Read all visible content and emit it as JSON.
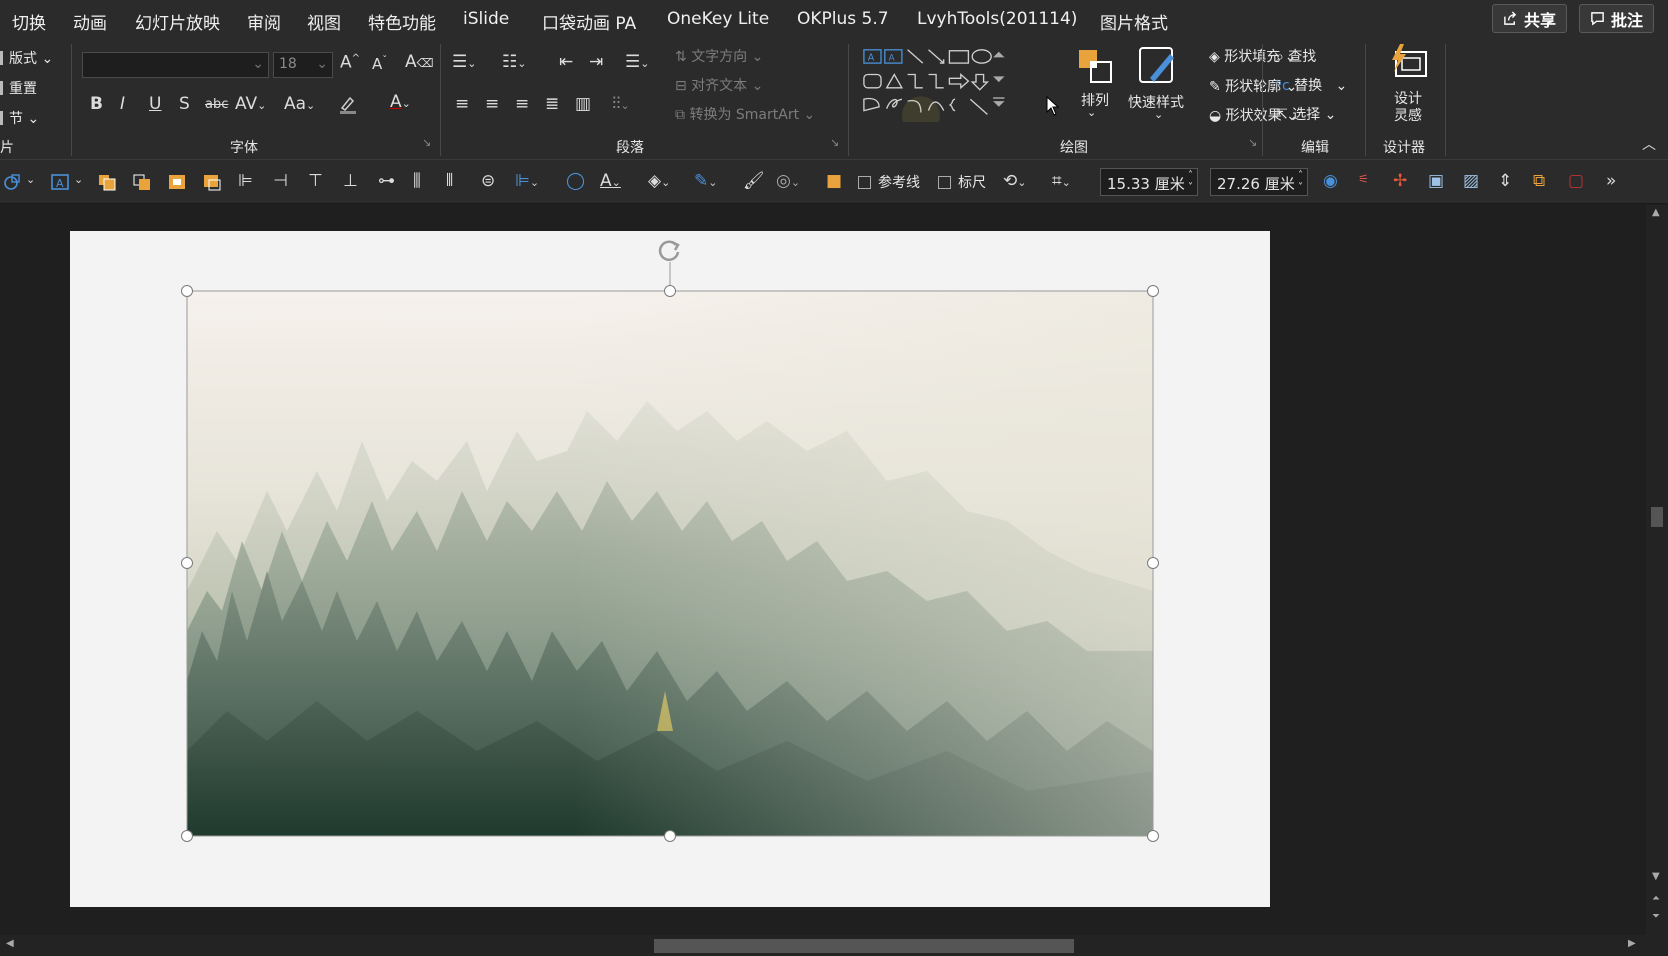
{
  "tabs": [
    "切换",
    "动画",
    "幻灯片放映",
    "审阅",
    "视图",
    "特色功能",
    "iSlide",
    "口袋动画 PA",
    "OneKey Lite",
    "OKPlus 5.7",
    "LvyhTools(201114)",
    "图片格式"
  ],
  "top_right": {
    "share": "共享",
    "comment": "批注"
  },
  "slides_group": {
    "layout": "版式",
    "reset": "重置",
    "section": "节",
    "label_fragment": "片"
  },
  "font_group": {
    "label": "字体",
    "font_size": "18",
    "bold": "B",
    "italic": "I",
    "underline": "U",
    "shadow": "S",
    "strike": "abc",
    "spacing": "AV",
    "case": "Aa",
    "font_color_glyph": "A"
  },
  "paragraph_group": {
    "label": "段落",
    "text_direction": "文字方向",
    "align_text": "对齐文本",
    "smartart": "转换为 SmartArt"
  },
  "drawing_group": {
    "label": "绘图",
    "arrange": "排列",
    "quick_styles": "快速样式",
    "shape_fill": "形状填充",
    "shape_outline": "形状轮廓",
    "shape_effects": "形状效果"
  },
  "editing_group": {
    "label": "编辑",
    "find": "查找",
    "replace": "替换",
    "select": "选择"
  },
  "designer_group": {
    "label": "设计器",
    "design_ideas_line1": "设计",
    "design_ideas_line2": "灵感"
  },
  "quick_access": {
    "guides": "参考线",
    "ruler": "标尺",
    "height": "15.33 厘米",
    "width": "27.26 厘米",
    "more": "»"
  },
  "colors": {
    "accent": "#e8a33c",
    "ribbon_bg": "#2b2b2b",
    "canvas_bg": "#1f1f1f",
    "slide_bg": "#f3f3f3"
  }
}
